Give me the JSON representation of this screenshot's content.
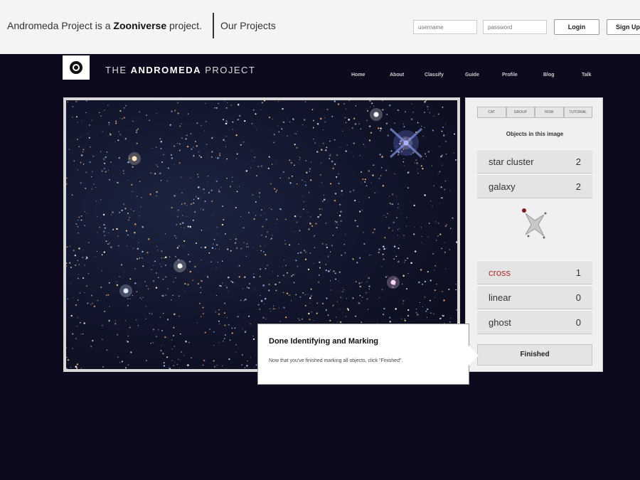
{
  "zooniverse_bar": {
    "tagline_prefix": "Andromeda Project is a",
    "tagline_brand": "Zooniverse",
    "tagline_suffix": "project.",
    "our_projects": "Our Projects",
    "username_placeholder": "username",
    "password_placeholder": "password",
    "login_label": "Login",
    "signup_label": "Sign Up"
  },
  "header": {
    "brand_prefix": "THE",
    "brand_bold": "ANDROMEDA",
    "brand_suffix": "PROJECT",
    "nav": [
      "Home",
      "About",
      "Classify",
      "Guide",
      "Profile",
      "Blog",
      "Talk"
    ]
  },
  "panel": {
    "tabs": [
      "CAT",
      "GROUP",
      "ROW",
      "TUTORIAL"
    ],
    "objects_title": "Objects in this image",
    "counts": [
      {
        "label": "star cluster",
        "count": "2"
      },
      {
        "label": "galaxy",
        "count": "2"
      }
    ],
    "artifacts": [
      {
        "label": "cross",
        "count": "1"
      },
      {
        "label": "linear",
        "count": "0"
      },
      {
        "label": "ghost",
        "count": "0"
      }
    ],
    "finished_label": "Finished"
  },
  "tooltip": {
    "title": "Done Identifying and Marking",
    "body": "Now that you've finished marking all objects, click \"Finished\"."
  },
  "colors": {
    "page_bg": "#0c0a1c",
    "top_bar_bg": "#f4f4f4",
    "panel_bg": "#f0f0f0",
    "artifact_red": "#b03030"
  }
}
